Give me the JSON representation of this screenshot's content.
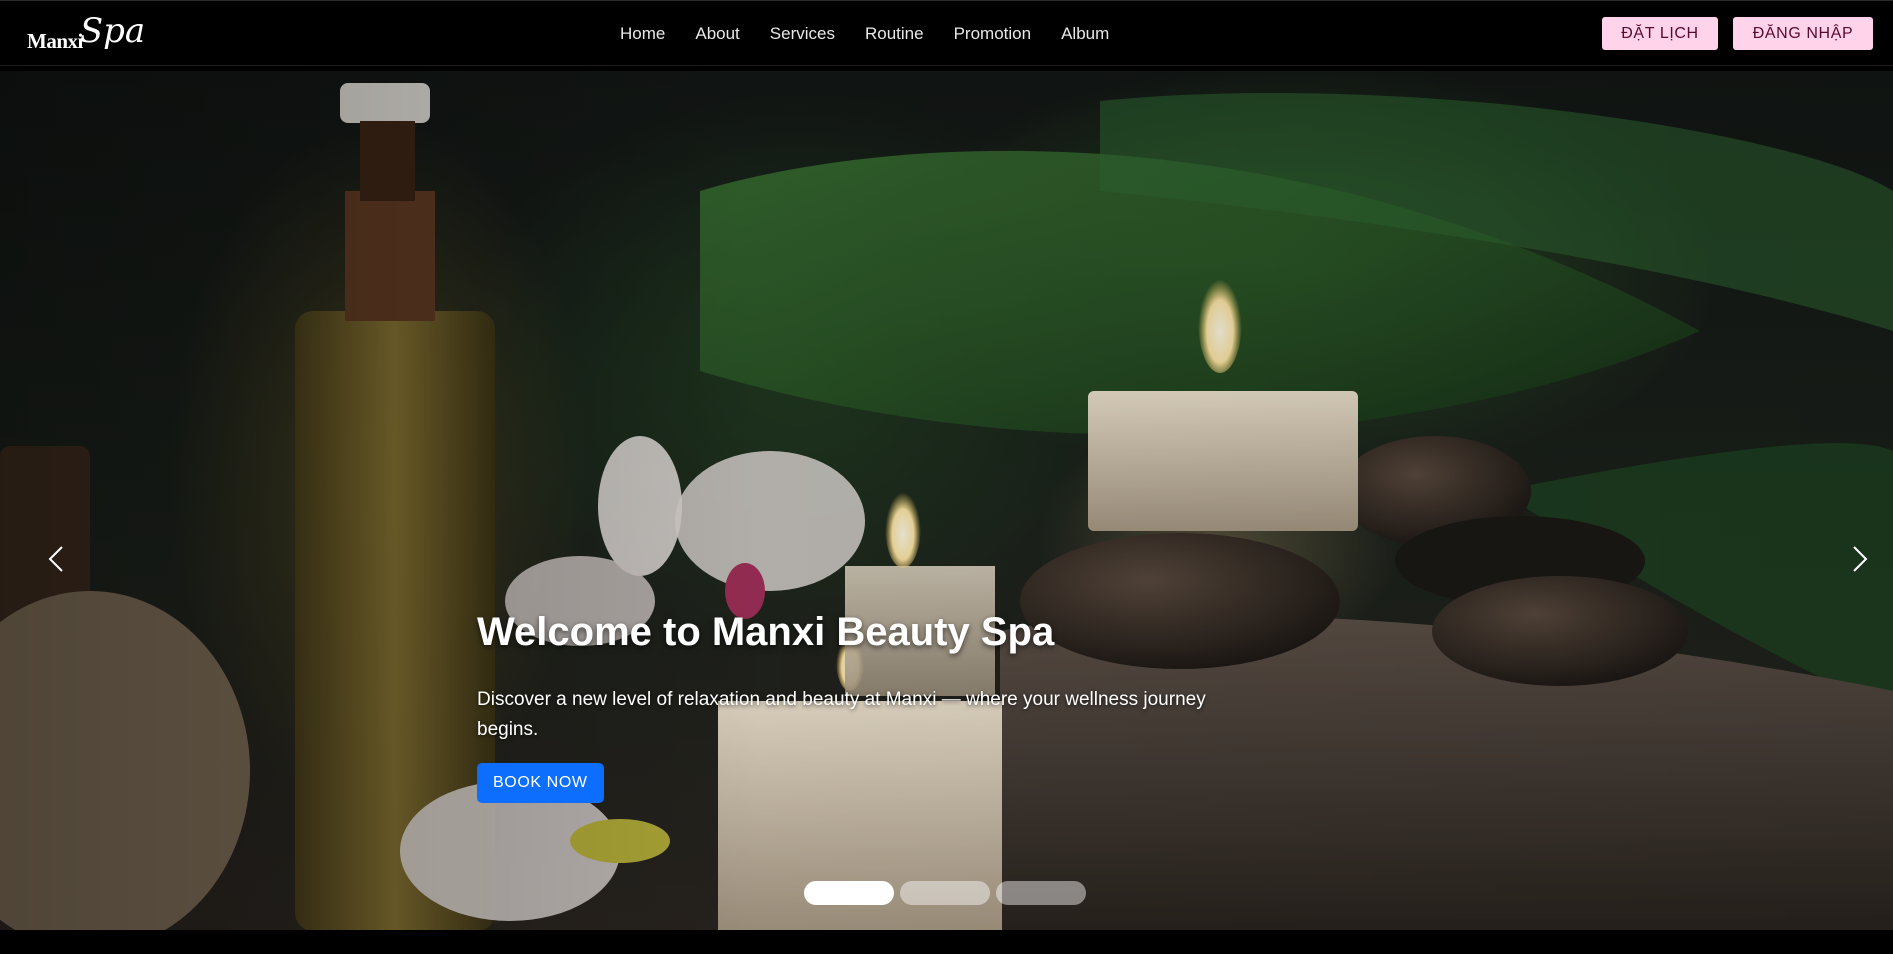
{
  "brand": {
    "logo_part1": "Manxi",
    "logo_part2": "Spa"
  },
  "nav": {
    "items": [
      {
        "label": "Home"
      },
      {
        "label": "About"
      },
      {
        "label": "Services"
      },
      {
        "label": "Routine"
      },
      {
        "label": "Promotion"
      },
      {
        "label": "Album"
      }
    ],
    "book_button": "ĐẶT LỊCH",
    "login_button": "ĐĂNG NHẬP",
    "button_color": "#ffd3ea"
  },
  "hero": {
    "title": "Welcome to Manxi Beauty Spa",
    "subtitle": "Discover a new level of relaxation and beauty at Manxi — where your wellness journey begins.",
    "cta_label": "BOOK NOW",
    "cta_color": "#0d6efd",
    "prev_icon": "chevron-left-icon",
    "next_icon": "chevron-right-icon"
  },
  "carousel": {
    "slide_count": 3,
    "active_index": 0
  }
}
